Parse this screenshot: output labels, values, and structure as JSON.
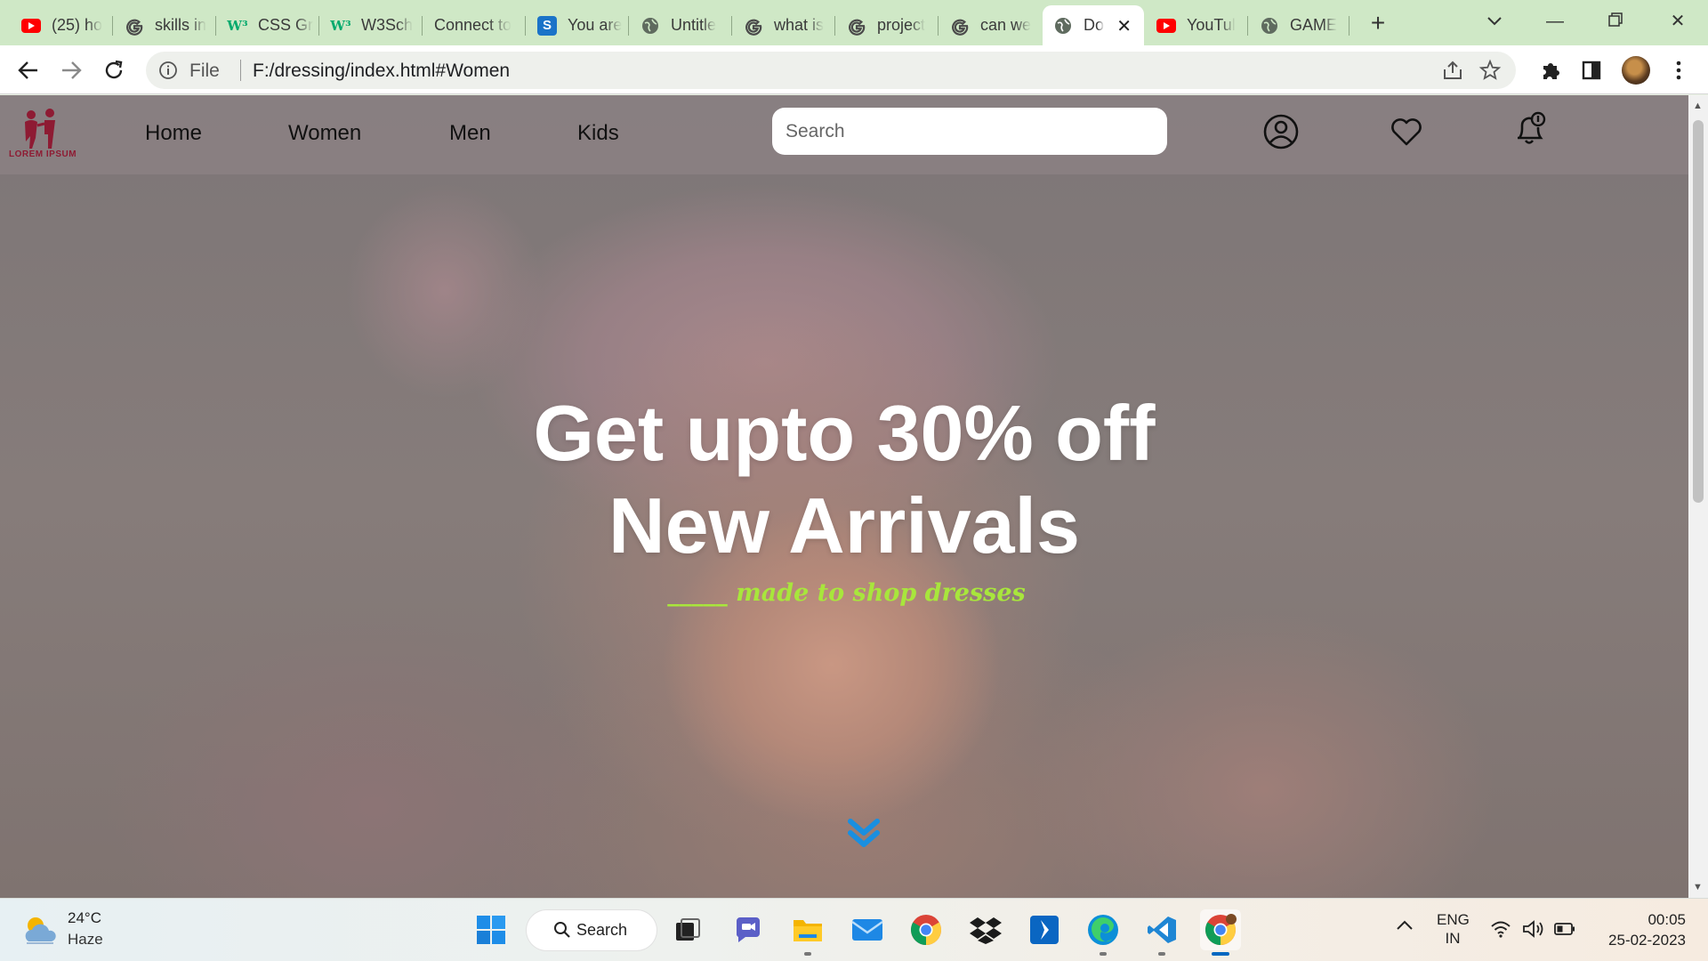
{
  "browser": {
    "tabs": [
      {
        "title": "(25) ho",
        "icon": "youtube-icon"
      },
      {
        "title": "skills in",
        "icon": "google-icon"
      },
      {
        "title": "CSS Gr",
        "icon": "w3schools-icon"
      },
      {
        "title": "W3Sch",
        "icon": "w3schools-icon"
      },
      {
        "title": "Connect to",
        "icon": "none"
      },
      {
        "title": "You are",
        "icon": "s-app-icon"
      },
      {
        "title": "Untitle",
        "icon": "globe-icon"
      },
      {
        "title": "what is",
        "icon": "google-icon"
      },
      {
        "title": "project",
        "icon": "google-icon"
      },
      {
        "title": "can we",
        "icon": "google-icon"
      },
      {
        "title": "Do",
        "icon": "globe-icon",
        "active": true
      },
      {
        "title": "YouTul",
        "icon": "youtube-icon"
      },
      {
        "title": "GAME",
        "icon": "globe-icon"
      }
    ],
    "address": {
      "scheme_label": "File",
      "url": "F:/dressing/index.html#Women"
    }
  },
  "site": {
    "logo_text": "LOREM IPSUM",
    "nav": [
      "Home",
      "Women",
      "Men",
      "Kids"
    ],
    "search_placeholder": "Search",
    "hero": {
      "headline_line1": "Get upto 30% off",
      "headline_line2": "New Arrivals",
      "tagline": "_____ made to shop dresses"
    }
  },
  "taskbar": {
    "weather": {
      "temp": "24°C",
      "condition": "Haze"
    },
    "search_label": "Search",
    "language": {
      "line1": "ENG",
      "line2": "IN"
    },
    "clock": {
      "time": "00:05",
      "date": "25-02-2023"
    }
  },
  "colors": {
    "tab_strip": "#cfe8c6",
    "logo_red": "#8e1b33",
    "tagline_green": "#a8e63c",
    "scroll_arrow_blue": "#1a8fe0"
  }
}
